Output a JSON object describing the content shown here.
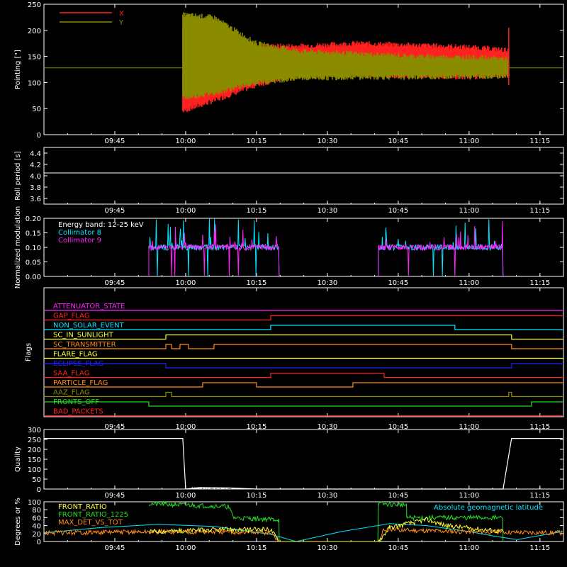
{
  "time_ticks": [
    "09:45",
    "10:00",
    "10:15",
    "10:30",
    "10:45",
    "11:00",
    "11:15"
  ],
  "colors": {
    "axis": "#ffffff",
    "red": "#ff2020",
    "olive": "#8b8b00",
    "cyan": "#00e5ff",
    "magenta": "#ff22ff",
    "green": "#22dd22",
    "orange": "#ff8c1a",
    "yellow": "#ffff33",
    "blue": "#2020ff"
  },
  "chart_data": [
    {
      "type": "line",
      "id": "pointing",
      "ylabel": "Pointing [\"]",
      "ylim": [
        0,
        250
      ],
      "yticks": [
        "0",
        "50",
        "100",
        "150",
        "200",
        "250"
      ],
      "legend": [
        "X",
        "Y"
      ],
      "series": [
        {
          "name": "X",
          "color": "#ff2020",
          "envelope_t": [
            9.99,
            10.1,
            10.25,
            10.4,
            10.6,
            10.8,
            11.0,
            11.14
          ],
          "upper": [
            205,
            200,
            170,
            170,
            175,
            172,
            168,
            162
          ],
          "lower": [
            45,
            65,
            95,
            115,
            115,
            112,
            110,
            115
          ]
        },
        {
          "name": "Y",
          "color": "#8b8b00",
          "envelope_t": [
            9.99,
            10.1,
            10.25,
            10.4,
            10.6,
            10.8,
            11.0,
            11.14
          ],
          "upper": [
            230,
            225,
            175,
            160,
            155,
            150,
            148,
            145
          ],
          "lower": [
            70,
            80,
            100,
            108,
            110,
            110,
            112,
            112
          ]
        }
      ],
      "baseline": 128
    },
    {
      "type": "line",
      "id": "roll_period",
      "ylabel": "Roll period [s]",
      "ylim": [
        3.5,
        4.5
      ],
      "yticks": [
        "3.6",
        "3.8",
        "4.0",
        "4.2",
        "4.4"
      ],
      "series": [
        {
          "name": "",
          "color": "#ffffff",
          "value": 4.05
        }
      ]
    },
    {
      "type": "line",
      "id": "modulation",
      "ylabel": "Normalized modulation",
      "ylim": [
        0,
        0.2
      ],
      "yticks": [
        "0.00",
        "0.05",
        "0.10",
        "0.15",
        "0.20"
      ],
      "legend": [
        "Energy band: 12-25 keV",
        "Collimator 8",
        "Collimator 9"
      ],
      "active_intervals": [
        [
          9.87,
          10.33
        ],
        [
          10.68,
          11.12
        ]
      ],
      "level": 0.1
    },
    {
      "type": "line",
      "id": "flags",
      "ylabel": "Flags",
      "flags": [
        {
          "name": "ATTENUATOR_STATE",
          "color": "#ff22ff",
          "steps": [
            [
              9.5,
              0
            ]
          ]
        },
        {
          "name": "GAP_FLAG",
          "color": "#ff2020",
          "steps": [
            [
              9.5,
              0
            ],
            [
              10.3,
              1
            ]
          ]
        },
        {
          "name": "NON_SOLAR_EVENT",
          "color": "#00e5ff",
          "steps": [
            [
              9.5,
              0
            ],
            [
              10.3,
              1
            ],
            [
              10.95,
              0
            ]
          ]
        },
        {
          "name": "SC_IN_SUNLIGHT",
          "color": "#ffff33",
          "steps": [
            [
              9.5,
              0
            ],
            [
              9.93,
              1
            ],
            [
              11.15,
              0
            ]
          ]
        },
        {
          "name": "SC_TRANSMITTER",
          "color": "#ff8c1a",
          "steps": [
            [
              9.5,
              0
            ],
            [
              9.93,
              1
            ],
            [
              9.95,
              0
            ],
            [
              9.98,
              1
            ],
            [
              10.01,
              0
            ],
            [
              10.1,
              1
            ],
            [
              11.15,
              0
            ]
          ]
        },
        {
          "name": "FLARE_FLAG",
          "color": "#ffff33",
          "steps": [
            [
              9.5,
              0
            ]
          ]
        },
        {
          "name": "ECLIPSE_FLAG",
          "color": "#2020ff",
          "steps": [
            [
              9.5,
              1
            ],
            [
              9.93,
              0
            ],
            [
              11.15,
              1
            ]
          ]
        },
        {
          "name": "SAA_FLAG",
          "color": "#ff2020",
          "steps": [
            [
              9.5,
              0
            ],
            [
              10.3,
              1
            ],
            [
              10.7,
              0
            ]
          ]
        },
        {
          "name": "PARTICLE_FLAG",
          "color": "#ff8c1a",
          "steps": [
            [
              9.5,
              0
            ],
            [
              10.06,
              1
            ],
            [
              10.25,
              0
            ],
            [
              10.59,
              1
            ]
          ]
        },
        {
          "name": "AAZ_FLAG",
          "color": "#8b8b00",
          "steps": [
            [
              9.5,
              0
            ],
            [
              9.93,
              1
            ],
            [
              9.95,
              0
            ],
            [
              11.14,
              1
            ],
            [
              11.15,
              0
            ]
          ]
        },
        {
          "name": "FRONTS_OFF",
          "color": "#22dd22",
          "steps": [
            [
              9.5,
              1
            ],
            [
              9.87,
              0
            ],
            [
              11.22,
              1
            ]
          ]
        },
        {
          "name": "BAD_PACKETS",
          "color": "#ff2020",
          "steps": [
            [
              9.5,
              0
            ]
          ]
        }
      ]
    },
    {
      "type": "line",
      "id": "quality",
      "ylabel": "Quality",
      "ylim": [
        0,
        300
      ],
      "yticks": [
        "0",
        "50",
        "100",
        "150",
        "200",
        "250",
        "300"
      ],
      "series": [
        {
          "name": "",
          "color": "#ffffff",
          "points": [
            [
              9.5,
              255
            ],
            [
              9.99,
              255
            ],
            [
              10.0,
              0
            ],
            [
              10.05,
              8
            ],
            [
              10.15,
              6
            ],
            [
              10.25,
              0
            ],
            [
              11.12,
              0
            ],
            [
              11.15,
              255
            ],
            [
              11.33,
              255
            ]
          ]
        }
      ]
    },
    {
      "type": "line",
      "id": "degrees",
      "ylabel": "Degrees or %",
      "ylim": [
        0,
        100
      ],
      "yticks": [
        "0",
        "20",
        "40",
        "60",
        "80",
        "100"
      ],
      "legend": [
        "FRONT_RATIO",
        "FRONT_RATIO_1225",
        "MAX_DET_VS_TOT",
        "Absolute geomagnetic latitude"
      ],
      "series": [
        {
          "name": "Absolute geomagnetic latitude",
          "color": "#00e5ff",
          "points": [
            [
              9.5,
              22
            ],
            [
              9.7,
              35
            ],
            [
              9.9,
              43
            ],
            [
              10.1,
              38
            ],
            [
              10.3,
              18
            ],
            [
              10.39,
              0
            ],
            [
              10.55,
              25
            ],
            [
              10.72,
              45
            ],
            [
              10.85,
              40
            ],
            [
              11.0,
              25
            ],
            [
              11.1,
              12
            ],
            [
              11.17,
              5
            ],
            [
              11.33,
              25
            ]
          ]
        },
        {
          "name": "FRONT_RATIO_1225",
          "color": "#22dd22",
          "points": [
            [
              9.87,
              95
            ],
            [
              10.0,
              92
            ],
            [
              10.15,
              88
            ],
            [
              10.17,
              60
            ],
            [
              10.33,
              55
            ],
            [
              10.33,
              0
            ],
            [
              10.68,
              0
            ],
            [
              10.68,
              95
            ],
            [
              10.78,
              92
            ],
            [
              10.78,
              60
            ],
            [
              11.12,
              60
            ],
            [
              11.12,
              0
            ]
          ]
        },
        {
          "name": "MAX_DET_VS_TOT",
          "color": "#ff8c1a",
          "points": [
            [
              9.5,
              22
            ],
            [
              10.0,
              25
            ],
            [
              10.3,
              22
            ],
            [
              10.33,
              0
            ],
            [
              10.68,
              0
            ],
            [
              10.7,
              30
            ],
            [
              11.0,
              25
            ],
            [
              11.33,
              22
            ]
          ]
        },
        {
          "name": "FRONT_RATIO",
          "color": "#ffff33",
          "points": [
            [
              9.87,
              25
            ],
            [
              10.15,
              30
            ],
            [
              10.3,
              30
            ],
            [
              10.33,
              0
            ],
            [
              10.68,
              0
            ],
            [
              10.72,
              35
            ],
            [
              10.85,
              55
            ],
            [
              10.92,
              40
            ],
            [
              11.12,
              25
            ]
          ]
        }
      ]
    }
  ]
}
